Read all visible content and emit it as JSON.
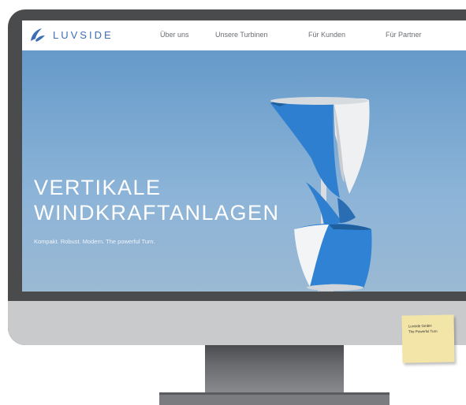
{
  "brand": {
    "name": "LUVSIDE"
  },
  "nav": {
    "items": [
      {
        "label": "Über uns"
      },
      {
        "label": "Unsere Turbinen"
      },
      {
        "label": "Für Kunden"
      },
      {
        "label": "Für Partner"
      }
    ]
  },
  "hero": {
    "title_line1": "VERTIKALE",
    "title_line2": "WINDKRAFTANLAGEN",
    "tagline": "Kompakt. Robust. Modern. The powerful Turn."
  },
  "sticky_note": {
    "line1": "Luvside GmbH",
    "line2": "The Powerful Turn"
  },
  "colors": {
    "brand_blue": "#3c6fb5",
    "sky": "#77a6d0",
    "monitor_bezel": "#4a4b4d",
    "monitor_chin": "#c9cacc",
    "note": "#f3e5a8"
  },
  "icons": {
    "logo": "luvside-logo-icon"
  }
}
